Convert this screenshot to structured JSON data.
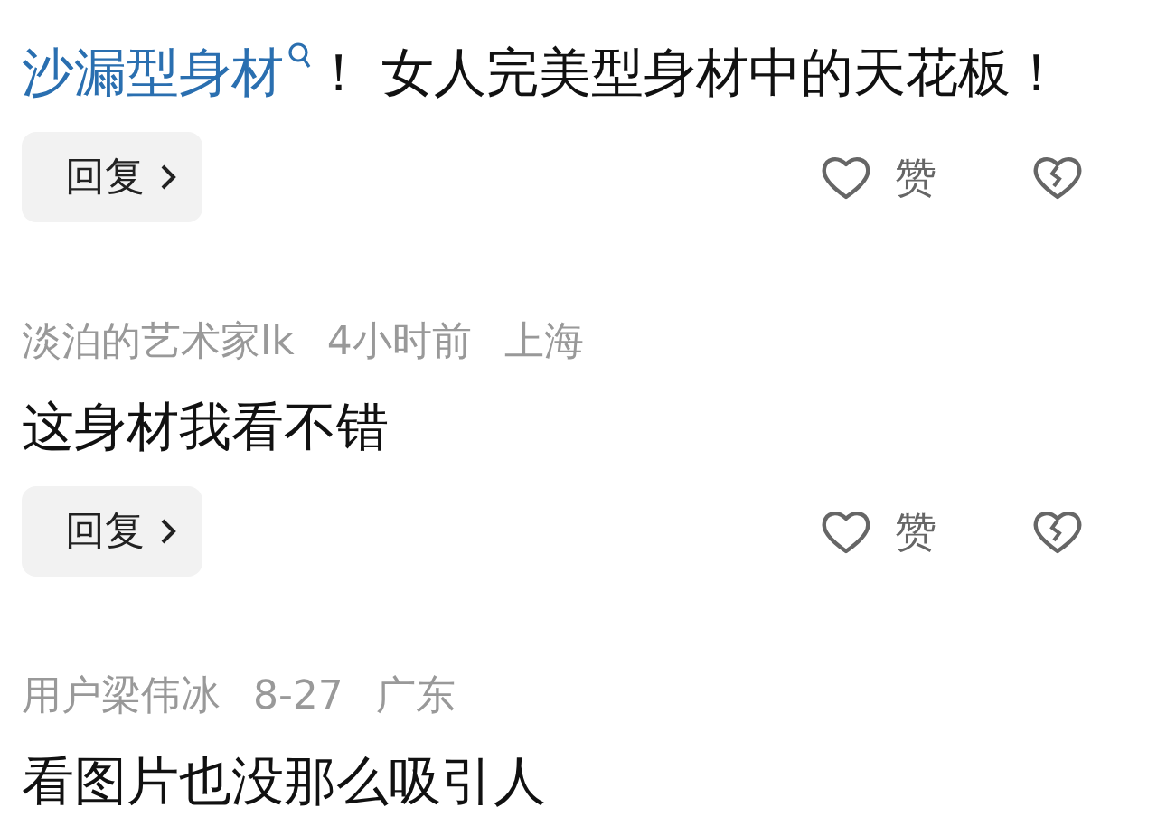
{
  "comments": [
    {
      "body": [
        {
          "kind": "link",
          "text": "沙漏型身材"
        },
        {
          "kind": "text",
          "text": "！ 女人完美型身材中的天花板！"
        }
      ],
      "reply_label": "回复",
      "like_label": "赞"
    },
    {
      "author": "淡泊的艺术家lk",
      "time": "4小时前",
      "location": "上海",
      "body": [
        {
          "kind": "text",
          "text": "这身材我看不错"
        }
      ],
      "reply_label": "回复",
      "like_label": "赞"
    },
    {
      "author": "用户梁伟冰",
      "time": "8-27",
      "location": "广东",
      "body": [
        {
          "kind": "text",
          "text": "看图片也没那么吸引人"
        }
      ]
    }
  ]
}
